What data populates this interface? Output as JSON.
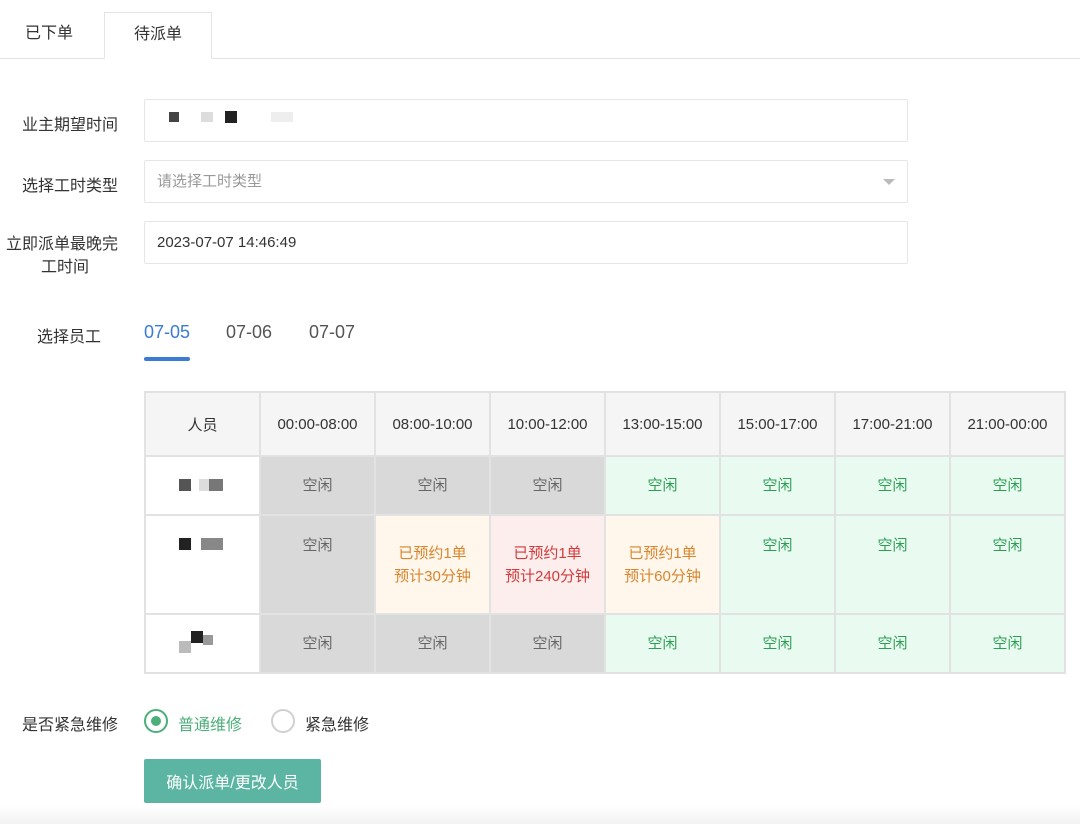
{
  "tabs": [
    {
      "label": "已下单",
      "active": false
    },
    {
      "label": "待派单",
      "active": true
    }
  ],
  "form": {
    "owner_time_label": "业主期望时间",
    "work_type_label": "选择工时类型",
    "work_type_placeholder": "请选择工时类型",
    "latest_finish_label_line1": "立即派单最晚完",
    "latest_finish_label_line2": "工时间",
    "latest_finish_value": "2023-07-07 14:46:49",
    "select_staff_label": "选择员工"
  },
  "date_tabs": [
    {
      "label": "07-05",
      "active": true
    },
    {
      "label": "07-06",
      "active": false
    },
    {
      "label": "07-07",
      "active": false
    }
  ],
  "schedule": {
    "headers": [
      "人员",
      "00:00-08:00",
      "08:00-10:00",
      "10:00-12:00",
      "13:00-15:00",
      "15:00-17:00",
      "17:00-21:00",
      "21:00-00:00"
    ],
    "rows": [
      {
        "cells": [
          {
            "text": "空闲",
            "status": "busy"
          },
          {
            "text": "空闲",
            "status": "busy"
          },
          {
            "text": "空闲",
            "status": "busy"
          },
          {
            "text": "空闲",
            "status": "free"
          },
          {
            "text": "空闲",
            "status": "free"
          },
          {
            "text": "空闲",
            "status": "free"
          },
          {
            "text": "空闲",
            "status": "free"
          }
        ]
      },
      {
        "cells": [
          {
            "text": "空闲",
            "status": "busy"
          },
          {
            "text": "已预约1单",
            "text2": "预计30分钟",
            "status": "orange"
          },
          {
            "text": "已预约1单",
            "text2": "预计240分钟",
            "status": "red"
          },
          {
            "text": "已预约1单",
            "text2": "预计60分钟",
            "status": "orange"
          },
          {
            "text": "空闲",
            "status": "free"
          },
          {
            "text": "空闲",
            "status": "free"
          },
          {
            "text": "空闲",
            "status": "free"
          }
        ]
      },
      {
        "cells": [
          {
            "text": "空闲",
            "status": "busy"
          },
          {
            "text": "空闲",
            "status": "busy"
          },
          {
            "text": "空闲",
            "status": "busy"
          },
          {
            "text": "空闲",
            "status": "free"
          },
          {
            "text": "空闲",
            "status": "free"
          },
          {
            "text": "空闲",
            "status": "free"
          },
          {
            "text": "空闲",
            "status": "free"
          }
        ]
      }
    ]
  },
  "urgent": {
    "label": "是否紧急维修",
    "options": [
      {
        "label": "普通维修",
        "checked": true
      },
      {
        "label": "紧急维修",
        "checked": false
      }
    ]
  },
  "confirm_button": "确认派单/更改人员",
  "colors": {
    "accent_blue": "#3a7bd5",
    "free_green": "#2f9e55",
    "busy_gray": "#d9d9d9",
    "booked_orange": "#d8862d",
    "booked_red": "#d23b3b",
    "button_teal": "#5bb5a2"
  }
}
